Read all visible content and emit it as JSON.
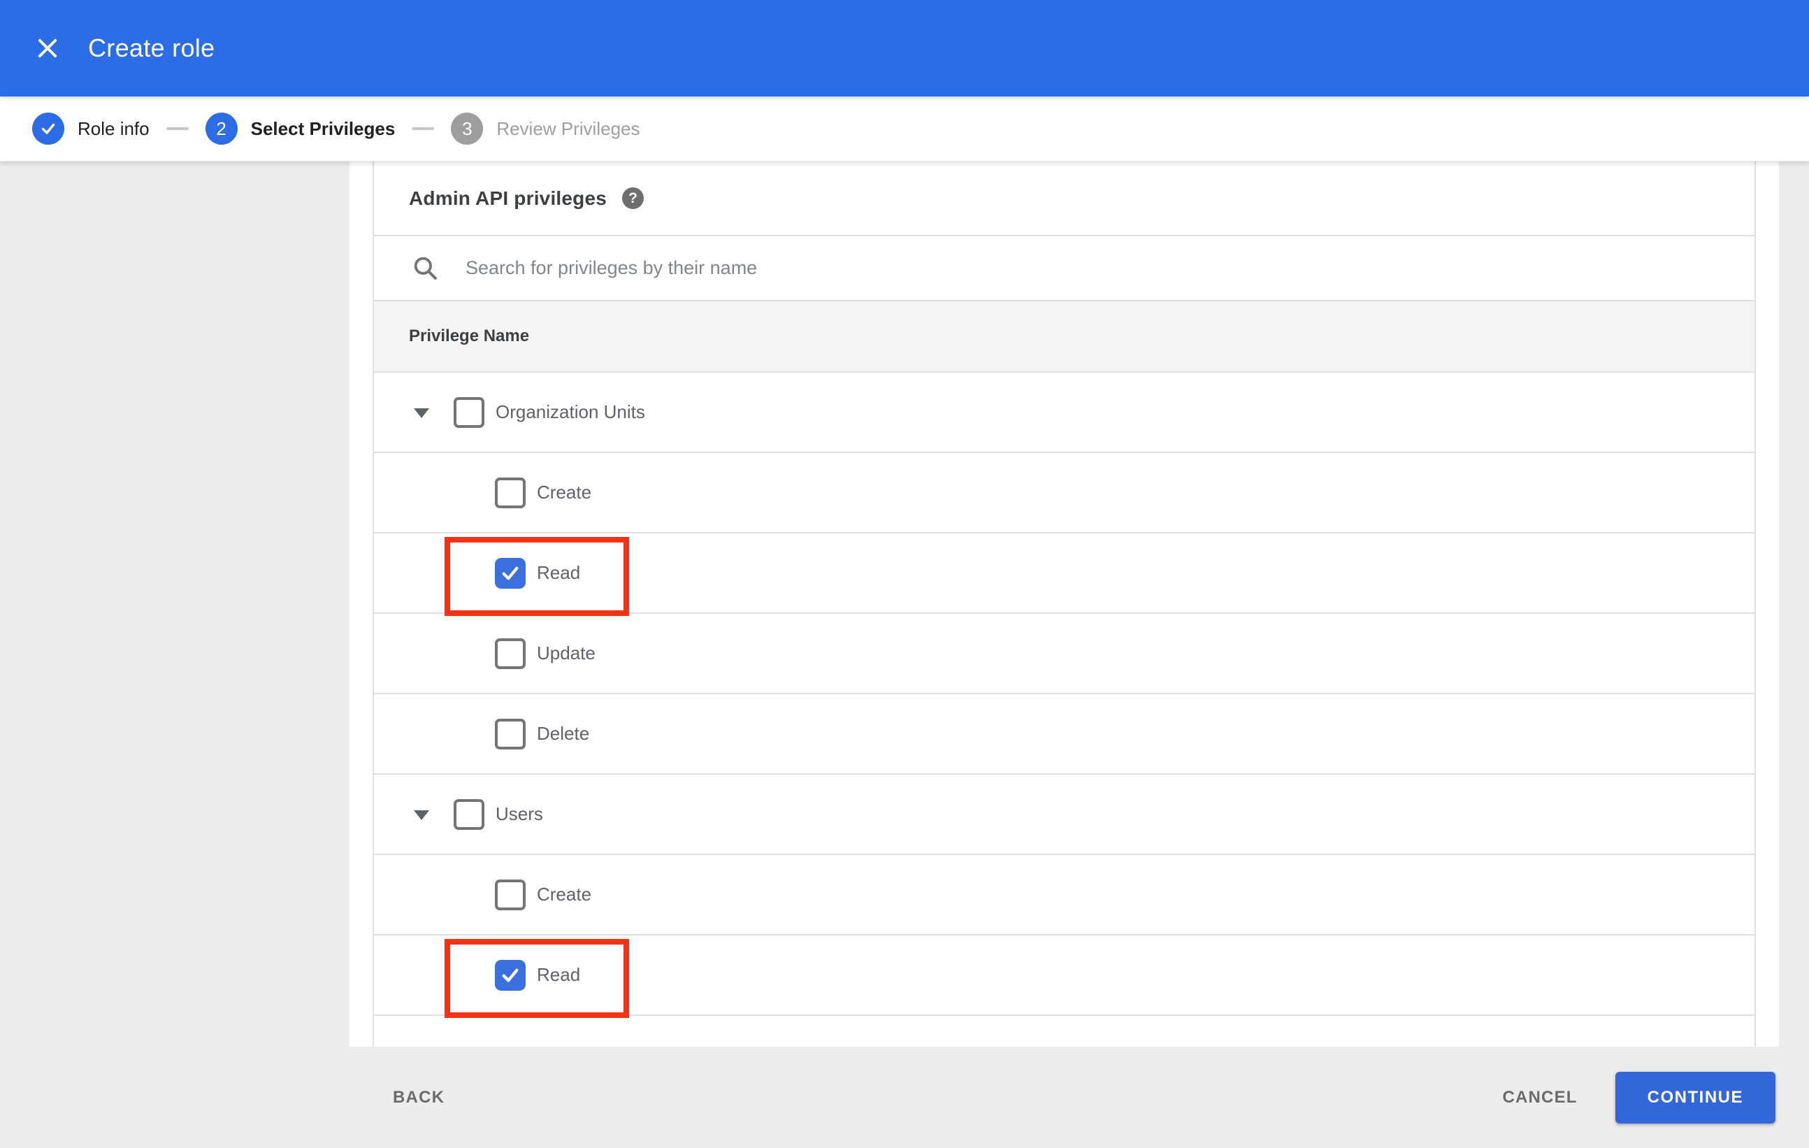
{
  "app_bar": {
    "title": "Create role"
  },
  "stepper": {
    "steps": [
      {
        "number": "",
        "label": "Role info",
        "state": "complete"
      },
      {
        "number": "2",
        "label": "Select Privileges",
        "state": "active"
      },
      {
        "number": "3",
        "label": "Review Privileges",
        "state": "inactive"
      }
    ]
  },
  "privileges": {
    "section_title": "Admin API privileges",
    "help_glyph": "?",
    "search_placeholder": "Search for privileges by their name",
    "header_label": "Privilege Name",
    "rows": [
      {
        "label": "Organization Units",
        "level": "parent",
        "checked": false,
        "highlighted": false
      },
      {
        "label": "Create",
        "level": "child",
        "checked": false,
        "highlighted": false
      },
      {
        "label": "Read",
        "level": "child",
        "checked": true,
        "highlighted": true
      },
      {
        "label": "Update",
        "level": "child",
        "checked": false,
        "highlighted": false
      },
      {
        "label": "Delete",
        "level": "child",
        "checked": false,
        "highlighted": false
      },
      {
        "label": "Users",
        "level": "parent",
        "checked": false,
        "highlighted": false
      },
      {
        "label": "Create",
        "level": "child",
        "checked": false,
        "highlighted": false
      },
      {
        "label": "Read",
        "level": "child",
        "checked": true,
        "highlighted": true
      }
    ]
  },
  "footer": {
    "back_label": "BACK",
    "cancel_label": "CANCEL",
    "continue_label": "CONTINUE"
  },
  "colors": {
    "header_blue": "#2c6ce4",
    "accent_blue": "#3b6fde",
    "button_blue": "#3366d9",
    "highlight_red": "#f23415",
    "panel_gray": "#ededed",
    "table_header_bg": "#f4f4f4",
    "divider": "#e0e0e0"
  }
}
